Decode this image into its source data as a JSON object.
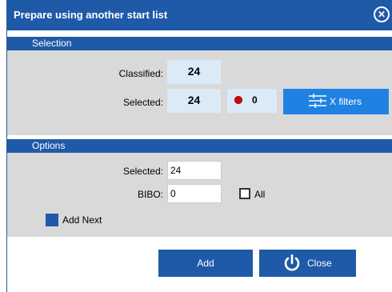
{
  "dialog": {
    "title": "Prepare using another start list",
    "close_icon": "close-circle-icon"
  },
  "selection": {
    "header": "Selection",
    "classified_label": "Classified:",
    "classified_value": "24",
    "selected_label": "Selected:",
    "selected_value": "24",
    "red_count": "0",
    "filters_button": "X filters",
    "filters_icon": "filter-sliders-icon"
  },
  "options": {
    "header": "Options",
    "selected_label": "Selected:",
    "selected_value": "24",
    "bibo_label": "BIBO:",
    "bibo_value": "0",
    "all_label": "All",
    "all_checked": false,
    "add_next_label": "Add Next",
    "add_next_checked": true
  },
  "footer": {
    "add_label": "Add",
    "close_label": "Close",
    "close_icon": "power-icon"
  },
  "colors": {
    "header_blue": "#1f5aa8",
    "accent_blue": "#1f82e2",
    "panel_gray": "#d9d9d9",
    "value_bg": "#dbeaf7",
    "status_red": "#e00000"
  }
}
